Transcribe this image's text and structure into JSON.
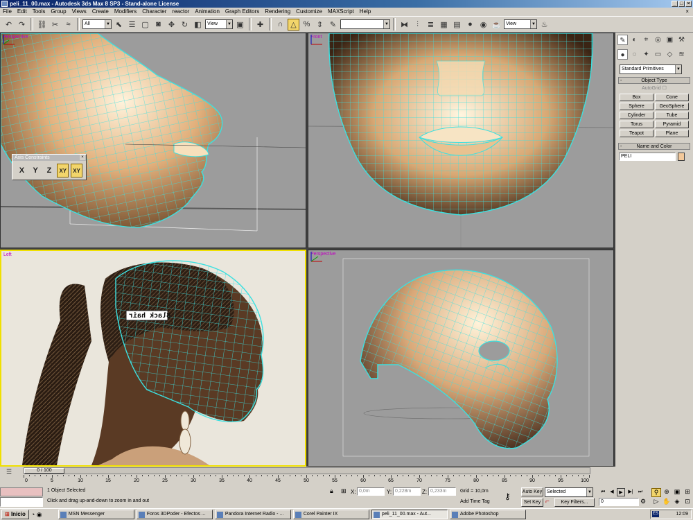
{
  "window": {
    "title": "peli_11_00.max - Autodesk 3ds Max 8 SP3 - Stand-alone License"
  },
  "menu": [
    "File",
    "Edit",
    "Tools",
    "Group",
    "Views",
    "Create",
    "Modifiers",
    "Character",
    "reactor",
    "Animation",
    "Graph Editors",
    "Rendering",
    "Customize",
    "MAXScript",
    "Help"
  ],
  "toolbar": {
    "selection_filter": "All",
    "ref_coord": "View",
    "named_selection": "",
    "view_dropdown": "View"
  },
  "viewports": {
    "top_left": "Perspective",
    "top_right": "Front",
    "bottom_left": "Left",
    "bottom_right": "Perspective",
    "overlay_text": "Black hair"
  },
  "axis_constraints": {
    "title": "Axis Constraints",
    "buttons": [
      "X",
      "Y",
      "Z",
      "XY",
      "XY"
    ]
  },
  "command_panel": {
    "dropdown": "Standard Primitives",
    "object_type_title": "Object Type",
    "autogrid": "AutoGrid",
    "primitives": [
      "Box",
      "Cone",
      "Sphere",
      "GeoSphere",
      "Cylinder",
      "Tube",
      "Torus",
      "Pyramid",
      "Teapot",
      "Plane"
    ],
    "name_color_title": "Name and Color",
    "name_value": "PELI",
    "name_color": "#f2c89a"
  },
  "timeline": {
    "frame_counter": "0 / 100",
    "ticks": [
      "0",
      "5",
      "10",
      "15",
      "20",
      "25",
      "30",
      "35",
      "40",
      "45",
      "50",
      "55",
      "60",
      "65",
      "70",
      "75",
      "80",
      "85",
      "90",
      "95",
      "100"
    ]
  },
  "status": {
    "selection": "1 Object Selected",
    "prompt": "Click and drag up-and-down to zoom in and out",
    "x_label": "X:",
    "x_value": "0,0m",
    "y_label": "Y:",
    "y_value": "0,228m",
    "z_label": "Z:",
    "z_value": "0,233m",
    "grid": "Grid = 10,0m",
    "add_time_tag": "Add Time Tag",
    "auto_key": "Auto Key",
    "set_key": "Set Key",
    "key_mode": "Selected",
    "key_filters": "Key Filters...",
    "current_frame": "0"
  },
  "taskbar": {
    "start": "Inicio",
    "tasks": [
      "MSN Messenger",
      "Foros 3DPoder - Efectos ...",
      "Pandora Internet Radio - ...",
      "Corel Painter IX",
      "peli_11_00.max - Aut...",
      "Adobe Photoshop"
    ],
    "lang": "ES",
    "clock": "12:09"
  },
  "colors": {
    "wire": "#3ce0e0",
    "skin": "#e6b888",
    "viewport_bg": "#9c9c9c",
    "active_border": "#f0e000",
    "title_bar": "#0a246a"
  }
}
